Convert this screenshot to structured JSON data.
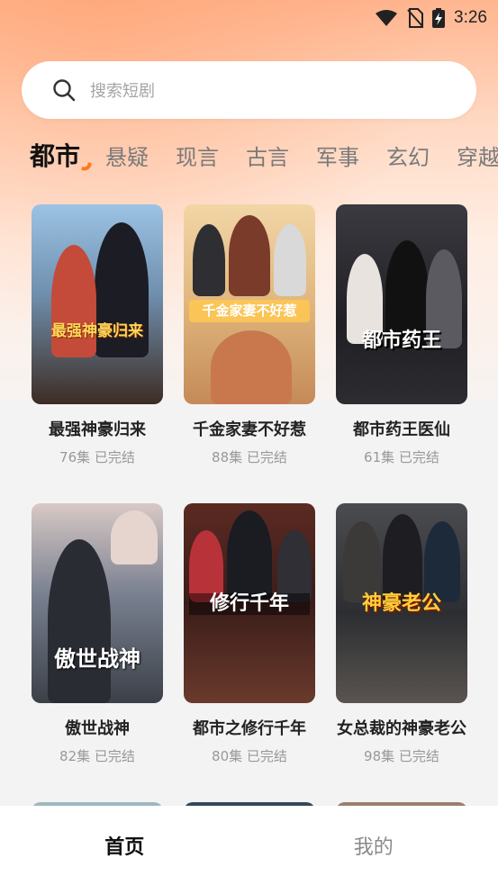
{
  "status_bar": {
    "time": "3:26"
  },
  "search": {
    "placeholder": "搜索短剧"
  },
  "tabs": [
    {
      "label": "都市",
      "active": true
    },
    {
      "label": "悬疑"
    },
    {
      "label": "现言"
    },
    {
      "label": "古言"
    },
    {
      "label": "军事"
    },
    {
      "label": "玄幻"
    },
    {
      "label": "穿越"
    }
  ],
  "dramas": [
    {
      "title": "最强神豪归来",
      "episodes": "76集",
      "status": "已完结",
      "poster_text": "最强神豪归来",
      "colors": [
        "#8ab4d6",
        "#3b2a22"
      ]
    },
    {
      "title": "千金家妻不好惹",
      "episodes": "88集",
      "status": "已完结",
      "poster_text": "千金家妻不好惹",
      "colors": [
        "#e8c48f",
        "#b47a45"
      ]
    },
    {
      "title": "都市药王医仙",
      "episodes": "61集",
      "status": "已完结",
      "poster_text": "都市药王",
      "colors": [
        "#2b2b30",
        "#6a6a70"
      ]
    },
    {
      "title": "傲世战神",
      "episodes": "82集",
      "status": "已完结",
      "poster_text": "傲世战神",
      "colors": [
        "#5d6470",
        "#c9c3c0"
      ]
    },
    {
      "title": "都市之修行千年",
      "episodes": "80集",
      "status": "已完结",
      "poster_text": "修行千年",
      "colors": [
        "#3a1d1a",
        "#8a3d2e"
      ]
    },
    {
      "title": "女总裁的神豪老公",
      "episodes": "98集",
      "status": "已完结",
      "poster_text": "神豪老公",
      "colors": [
        "#2f3236",
        "#7b7468"
      ]
    }
  ],
  "bottom_nav": [
    {
      "label": "首页",
      "active": true
    },
    {
      "label": "我的"
    }
  ]
}
